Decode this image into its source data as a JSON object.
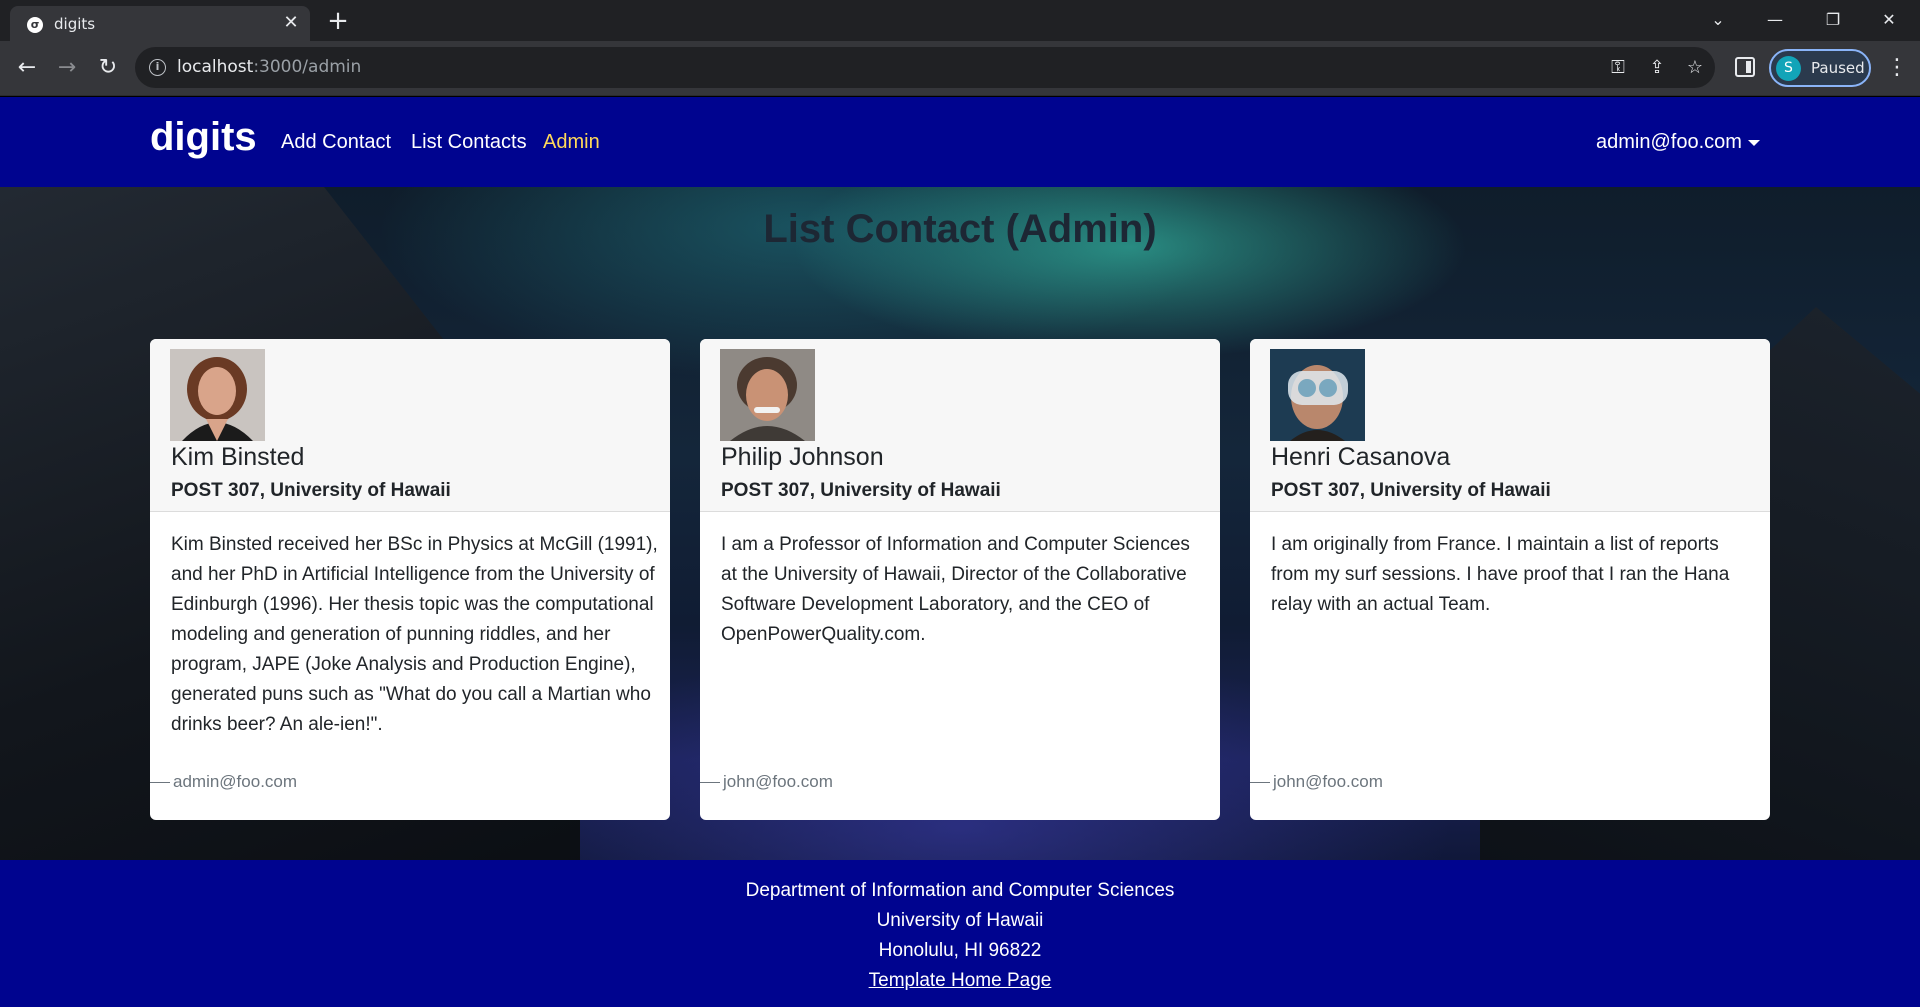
{
  "browser": {
    "tab_title": "digits",
    "url_host": "localhost",
    "url_path": ":3000/admin",
    "profile_initial": "S",
    "profile_status": "Paused"
  },
  "navbar": {
    "brand": "digits",
    "links": [
      "Add Contact",
      "List Contacts",
      "Admin"
    ],
    "active_link": "Admin",
    "user": "admin@foo.com"
  },
  "main": {
    "title": "List Contact (Admin)",
    "contacts": [
      {
        "name": "Kim Binsted",
        "address": "POST 307, University of Hawaii",
        "description": "Kim Binsted received her BSc in Physics at McGill (1991), and her PhD in Artificial Intelligence from the University of Edinburgh (1996). Her thesis topic was the computational modeling and generation of punning riddles, and her program, JAPE (Joke Analysis and Production Engine), generated puns such as \"What do you call a Martian who drinks beer? An ale-ien!\".",
        "owner": "admin@foo.com"
      },
      {
        "name": "Philip Johnson",
        "address": "POST 307, University of Hawaii",
        "description": "I am a Professor of Information and Computer Sciences at the University of Hawaii, Director of the Collaborative Software Development Laboratory, and the CEO of OpenPowerQuality.com.",
        "owner": "john@foo.com"
      },
      {
        "name": "Henri Casanova",
        "address": "POST 307, University of Hawaii",
        "description": "I am originally from France. I maintain a list of reports from my surf sessions. I have proof that I ran the Hana relay with an actual Team.",
        "owner": "john@foo.com"
      }
    ]
  },
  "footer": {
    "line1": "Department of Information and Computer Sciences",
    "line2": "University of Hawaii",
    "line3": "Honolulu, HI 96822",
    "link": "Template Home Page"
  },
  "colors": {
    "navbar_bg": "#00048f",
    "active_link": "#ffd95a"
  }
}
